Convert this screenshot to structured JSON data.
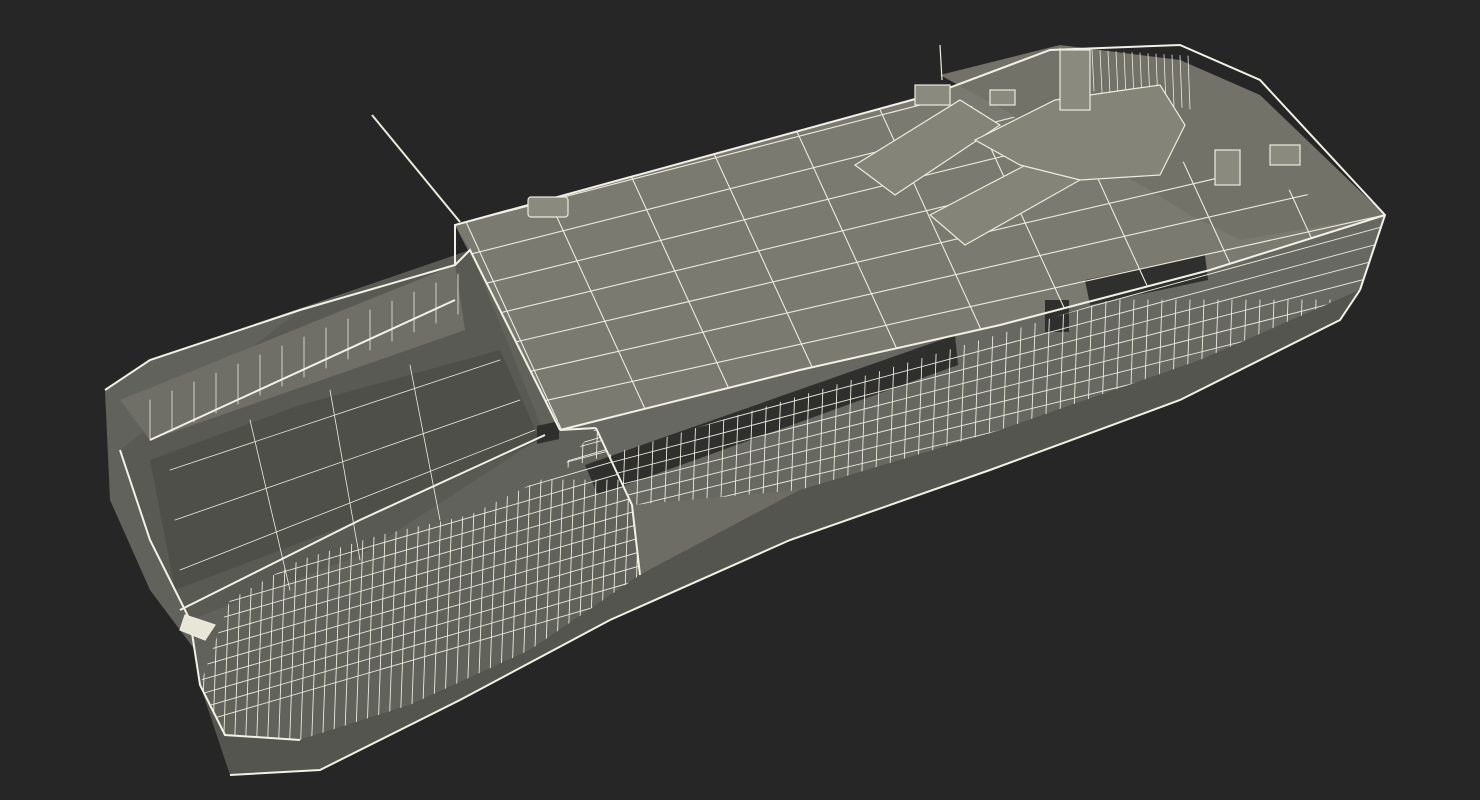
{
  "scene": {
    "subject": "ship-wireframe-render",
    "background_color": "#262626",
    "hull_color": "#6a6a63",
    "hull_shadow_color": "#4e4e49",
    "deck_color": "#75756c",
    "wire_color": "#ecebdd",
    "window_color": "#2e2e2c"
  }
}
